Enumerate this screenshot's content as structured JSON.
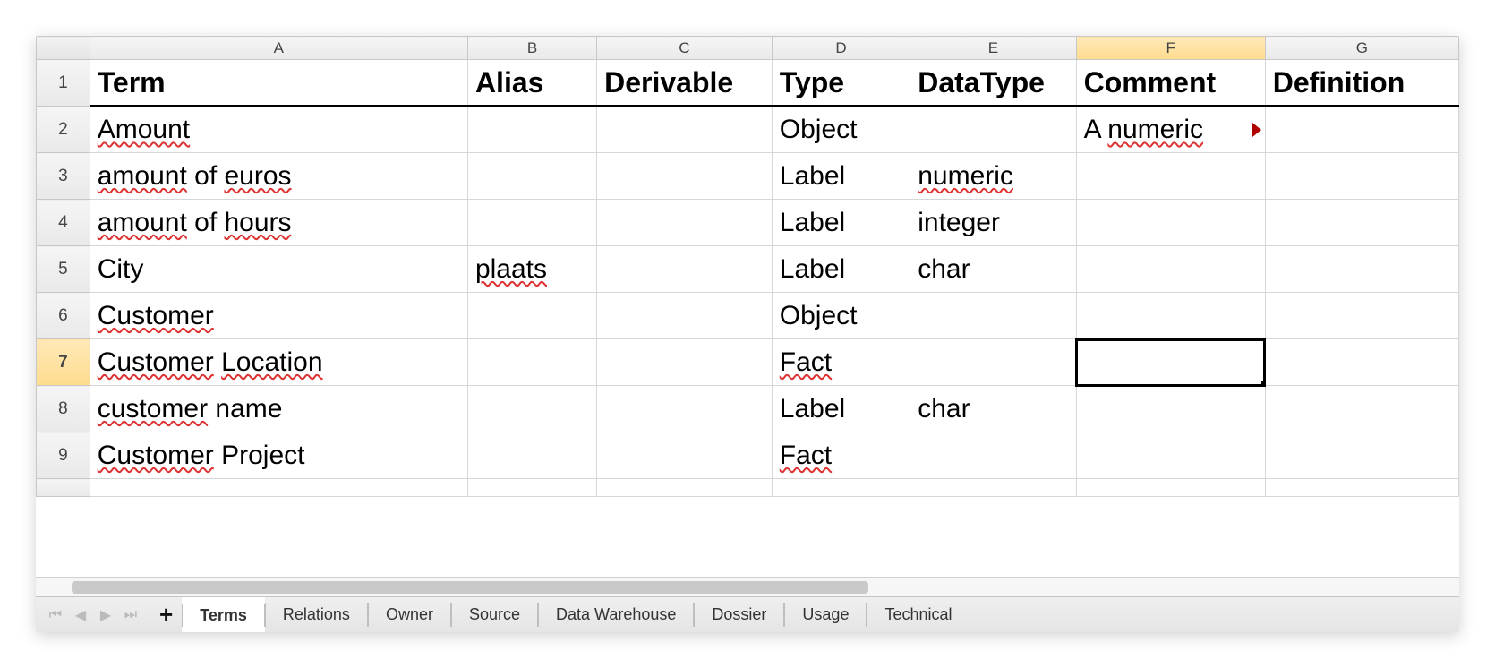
{
  "columns": [
    "A",
    "B",
    "C",
    "D",
    "E",
    "F",
    "G"
  ],
  "highlighted_column_index": 5,
  "highlighted_row_number": 7,
  "selected_cell": "F7",
  "header_row": {
    "term": "Term",
    "alias": "Alias",
    "derivable": "Derivable",
    "type": "Type",
    "datatype": "DataType",
    "comment": "Comment",
    "definition": "Definition"
  },
  "rows": [
    {
      "n": 1,
      "header": true
    },
    {
      "n": 2,
      "term": {
        "text": "Amount",
        "spell": true
      },
      "alias": "",
      "derivable": "",
      "type": "Object",
      "datatype": "",
      "comment": "A numeric ",
      "comment_overflow": true,
      "comment_spell_word": "numeric",
      "definition": ""
    },
    {
      "n": 3,
      "term": {
        "text": "amount of euros",
        "spell_words": [
          "amount",
          "euros"
        ]
      },
      "alias": "",
      "derivable": "",
      "type": "Label",
      "datatype": "numeric",
      "datatype_spell": true,
      "comment": "",
      "definition": ""
    },
    {
      "n": 4,
      "term": {
        "text": "amount of hours",
        "spell_words": [
          "amount",
          "hours"
        ]
      },
      "alias": "",
      "derivable": "",
      "type": "Label",
      "datatype": "integer",
      "comment": "",
      "definition": ""
    },
    {
      "n": 5,
      "term": {
        "text": "City"
      },
      "alias": "plaats",
      "alias_spell": true,
      "derivable": "",
      "type": "Label",
      "datatype": "char",
      "comment": "",
      "definition": ""
    },
    {
      "n": 6,
      "term": {
        "text": "Customer",
        "spell": true
      },
      "alias": "",
      "derivable": "",
      "type": "Object",
      "datatype": "",
      "comment": "",
      "definition": ""
    },
    {
      "n": 7,
      "term": {
        "text": "Customer Location",
        "spell_words": [
          "Customer",
          "Location"
        ]
      },
      "alias": "",
      "derivable": "",
      "type": "Fact",
      "type_spell": true,
      "datatype": "",
      "comment": "",
      "definition": ""
    },
    {
      "n": 8,
      "term": {
        "text": "customer name",
        "spell_words": [
          "customer"
        ]
      },
      "alias": "",
      "derivable": "",
      "type": "Label",
      "datatype": "char",
      "comment": "",
      "definition": ""
    },
    {
      "n": 9,
      "term": {
        "text": "Customer Project",
        "spell_words": [
          "Customer"
        ]
      },
      "alias": "",
      "derivable": "",
      "type": "Fact",
      "type_spell": true,
      "datatype": "",
      "comment": "",
      "definition": ""
    }
  ],
  "tabs": {
    "active_index": 0,
    "items": [
      "Terms",
      "Relations",
      "Owner",
      "Source",
      "Data Warehouse",
      "Dossier",
      "Usage",
      "Technical"
    ]
  },
  "nav": {
    "first": "⏮",
    "prev": "◀",
    "next": "▶",
    "last": "⏭",
    "add": "+"
  }
}
